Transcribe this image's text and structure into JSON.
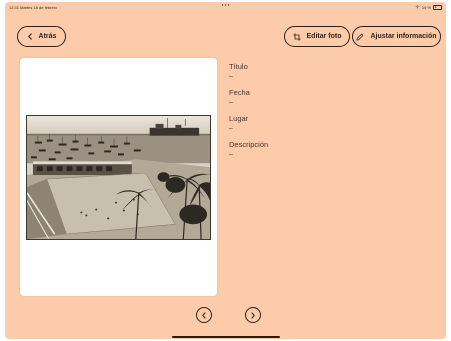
{
  "status_bar": {
    "time_date": "12:31  Martes 18 de febrero",
    "battery": "19 %"
  },
  "toolbar": {
    "back_label": "Atrás",
    "edit_photo_label": "Editar foto",
    "adjust_info_label": "Ajustar información"
  },
  "photo": {
    "description": "Vintage sepia photograph of a harbor with moored boats and a terraced plaza with palm trees"
  },
  "info": {
    "fields": [
      {
        "label": "Título",
        "value": "–"
      },
      {
        "label": "Fecha",
        "value": "–"
      },
      {
        "label": "Lugar",
        "value": "–"
      },
      {
        "label": "Descripción",
        "value": "–"
      }
    ]
  },
  "colors": {
    "background": "#fbcbaa",
    "foreground": "#2f1f16",
    "card": "#ffffff"
  },
  "icons": {
    "back": "chevron-left-icon",
    "edit": "crop-icon",
    "adjust": "pencil-icon",
    "prev": "chevron-left-icon",
    "next": "chevron-right-icon"
  }
}
